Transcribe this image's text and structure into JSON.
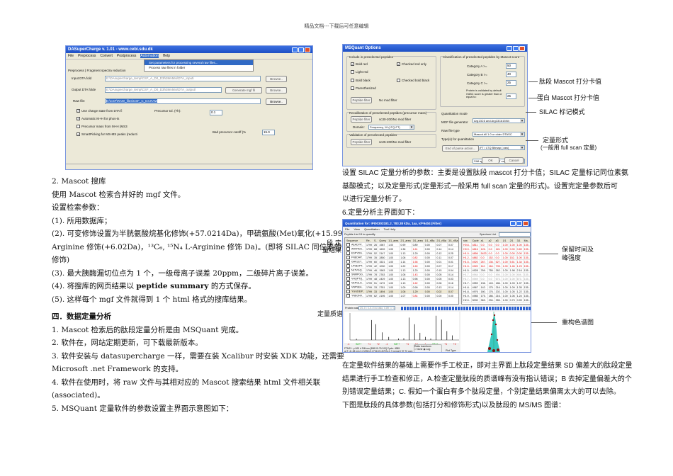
{
  "header": "精品文档---下载后可任意编辑",
  "dasc": {
    "title": "DASuperCharge v. 1.01  - www.cebi.sdu.dk",
    "menu": [
      "File",
      "Preprocess",
      "Convert",
      "Postprocess",
      "Automation",
      "Help"
    ],
    "dropdown": [
      "Set parameters for processing several raw files...",
      "Process raw files in folder"
    ],
    "tabs": [
      "Preprocess",
      "Fragment spectra reduction"
    ],
    "input_label": "Input DTA fold",
    "input_value": "E:\\DAsupercharge_temp\\CSF_A_D0_D3h38m56s\\DTA_input\\",
    "output_label": "Output DTA folde",
    "output_value": "E:\\DAsupercharge_temp\\CSF_A_D0_D3h38m56s\\DTA_output\\",
    "raw_label": "Raw file:",
    "raw_value": "E:\\CSF\\RAW_files\\CSF_C_D4.RAW",
    "browse": "Browse..",
    "generate": "Generate mgf fil",
    "checks": [
      {
        "label": "Use charge state from DTA fi",
        "checked": true
      },
      {
        "label": "Automatic M+H for phos-ts",
        "checked": true
      },
      {
        "label": "Precursor mass from M+H (MS3",
        "checked": false
      },
      {
        "label": "SmartPicking for MS-MS peaks (reducti",
        "checked": true
      }
    ],
    "tol_label": "Precursor tol. (Th):",
    "tol_value": "0.1",
    "cutoff_label": "Bad precursor cutoff (%",
    "cutoff_value": "15.0"
  },
  "left_text": {
    "l1": "2. Mascot 搜库",
    "l2": "使用 Mascot 检索合并好的 mgf 文件。",
    "l3": "设置检索参数：",
    "l4": "(1). 所用数据库；",
    "l5": "(2). 可变修饰设置为半胱氨酸烷基化修饰(+57.0214Da)，甲硫氨酸(Met)氧化(+15.99Da)，¹³C₆ L-",
    "l6": "Arginine 修饰(+6.02Da)，¹³C₆, ¹⁵N₄ L-Arginine 修饰 Da)。(即将 SILAC 同位素的修饰设置为可变",
    "l7": "修饰)",
    "l8": "(3). 最大胰酶漏切位点为 1 个，一级母离子误差 20ppm，二级碎片离子误差。",
    "l9a": "(4). 将搜库的网页结果以 ",
    "l9b": "peptide summary",
    "l9c": " 的方式保存。",
    "l10": "(5). 这样每个 mgf 文件就得到 1 个 html 格式的搜库结果。",
    "section": "四．数据定量分析",
    "s1": "1. Mascot 检索后的肽段定量分析是由 MSQuant 完成。",
    "s2": "2. 软件在，网站定期更新，可下载最新版本。",
    "s3": "3. 软件安装与 datasupercharge 一样，需要在装 Xcalibur 时安装 XDK 功能，还需要",
    "s4": "Microsoft .net Framework 的支持。",
    "s5": "4. 软件在使用时，将 raw 文件与其相对应的 Mascot 搜索结果 html 文件相关联",
    "s6": "(associated)。",
    "s7": "5. MSQuant 定量软件的参数设置主界面示意图如下："
  },
  "side_labels": {
    "quant_result": "段 定 量结果",
    "quant_spectrum": "定量质谱"
  },
  "msq": {
    "title": "MSQuant Options",
    "include_group": "Include in preselected peptides",
    "checks": [
      {
        "label": "Bold red",
        "checked": true
      },
      {
        "label": "Checked red only",
        "checked": true
      },
      {
        "label": "Light red",
        "checked": false
      },
      {
        "label": "Bold black",
        "checked": false
      },
      {
        "label": "Checked bold black",
        "checked": false
      },
      {
        "label": "Parenthesized",
        "checked": false
      }
    ],
    "peptide_filter": "Peptide filter",
    "no_mod_filter": "No mod filter",
    "recal_group": "Recalibration of preselected peptides (precursor mass)",
    "recal_filter": "sc30-200\\No mod filter",
    "domain_label": "Domain:",
    "domain_value": "Frequency, 1/f (LTQ-FT)",
    "valid_group": "Validation of preselected peptides",
    "valid_filter": "sc25-200\\No mod filter",
    "class_group": "Classification of preselected peptides by Mascot score",
    "cat_a": "Category A >=",
    "cat_a_val": "50",
    "cat_b": "Category B >=",
    "cat_b_val": "40",
    "cat_c": "Category C >=",
    "cat_c_val": "25",
    "protein_label": "Protein is validated by default if ABC score is greater than or equal to:",
    "protein_val": "25",
    "quant_mode_label": "Quantitation mode",
    "quant_mode": "Arg13C6 and Arg13C615N4",
    "mgf_label": "MGF file generator",
    "mgf": "Mascot.dll 1.0 or older DTASC",
    "raw_label": "Raw file type",
    "raw": "LTQ-FT / LTQ Bitmap (.raw)",
    "types_label": "Type(s) for quantitation",
    "types": "SIM spectra (LTQ-FT only)",
    "end_parse": "End of parse action...",
    "ok": "OK",
    "cancel": "Cancel"
  },
  "annotations": {
    "a1": "肽段 Mascot 打分卡值",
    "a2": "蛋白 Mascot 打分卡值",
    "a3": "SILAC 标记模式",
    "a4": "定量形式",
    "a5": "(一般用 full scan 定量)",
    "a6": "保留时间及",
    "a7": "峰强度",
    "a8": "重构色谱图"
  },
  "right_text": {
    "p1": "设置 SILAC 定量分析的参数：主要是设置肽段 mascot 打分卡值；SILAC 定量标记同位素氨",
    "p2": "基酸模式；以及定量形式(定量形式一般采用 full scan 定量的形式)。设置完定量参数后可",
    "p3": "以进行定量分析了。",
    "p4": "6.定量分析主界面如下：",
    "q1": "在定量软件结果的基础上需要作手工校正，即对主界面上肽段定量结果 SD 偏差大的肽段定量",
    "q2": "结果进行手工检查和修正，A.检查定量肽段的质谱峰有没有指认错误；B 去掉定量偏差大的个",
    "q3": "别错误定量结果；C. 假如一个蛋白有多个肽段定量，个别定量结果偏离太大的可以去除。",
    "q4": "下图是肽段的具体参数(包括打分和修饰形式)以及肽段的 MS/MS 图谱："
  },
  "quant": {
    "title": "Quantitation for: IPI00303181.2 ,783.38 kDa, 1aa, Id=9404 (Filter)",
    "menu": [
      "File",
      "View",
      "Quantitation",
      "Tool Help"
    ],
    "peptide_list": "Peptide List  13 to quantify",
    "spectrum_list": "Spectrum List",
    "pep_headers": [
      "Sequence",
      "Re..",
      "S..",
      "Query",
      "1/1_area",
      "2/1_area",
      "3/1_area",
      "1/1_rIBa",
      "2/1_rIBa",
      "3/1_rIBa",
      "1/1_SD"
    ],
    "pep_rows": [
      [
        "AEADYP..",
        "1799",
        "26",
        "1987",
        "1.00",
        "0.99",
        "0.89",
        "0.00",
        "0.07",
        "0.07",
        "1.00"
      ],
      [
        "ARVPEG..",
        "1799",
        "68",
        "1639",
        "1.00",
        "1.36",
        "1.61",
        "0.00",
        "0.14",
        "0.14",
        "1.00"
      ],
      [
        "ESPYDG..",
        "1799",
        "52",
        "2147",
        "1.00",
        "1.13",
        "1.29",
        "0.00",
        "0.12",
        "0.25",
        "1.00"
      ],
      [
        "FNEDHP..",
        "1799",
        "35",
        "2850",
        "1.00",
        "1.06",
        "0.82",
        "0.00",
        "0.11",
        "0.07",
        "1.00"
      ],
      [
        "GAKLEY..",
        "1799",
        "60",
        "1521",
        "1.00",
        "1.14",
        "1.56",
        "0.00",
        "0.01",
        "0.01",
        "1.00"
      ],
      [
        "LPSEJPT..",
        "1799",
        "42",
        "1030",
        "1.00",
        "1.22",
        "1.60",
        "0.00",
        "0.07",
        "0.17",
        "1.00"
      ],
      [
        "NLTVGQ..",
        "1799",
        "46",
        "1563",
        "1.00",
        "1.13",
        "1.20",
        "0.00",
        "0.15",
        "0.04",
        "1.00"
      ],
      [
        "SNMPGG..",
        "1799",
        "78",
        "2763",
        "1.00",
        "1.06",
        "1.43",
        "0.00",
        "0.05",
        "0.14",
        "1.00"
      ],
      [
        "VHQPTQ..",
        "1799",
        "48",
        "2429",
        "1.00",
        "1.13",
        "0.96",
        "0.00",
        "0.05",
        "0.03",
        "1.00"
      ],
      [
        "VEPGLG..",
        "1799",
        "51",
        "1173",
        "1.00",
        "1.13",
        "1.62",
        "0.00",
        "0.06",
        "0.16",
        "1.00"
      ],
      [
        "VNPSEA..",
        "1799",
        "33",
        "2781",
        "1.00",
        "1.09",
        "0.99",
        "0.00",
        "0.13",
        "0.14",
        "1.00"
      ],
      [
        "YGGDEIP..",
        "1799",
        "33",
        "1494",
        "1.00",
        "1.06",
        "1.29",
        "0.00",
        "0.02",
        "0.07",
        "1.00"
      ],
      [
        "YNEGNV..",
        "1799",
        "62",
        "2195",
        "1.00",
        "1.07",
        "0.84",
        "0.00",
        "0.00",
        "0.00",
        "1.00"
      ]
    ],
    "spec_headers": [
      "raw",
      "Cycle",
      "a1",
      "a2",
      "a3",
      "1/1",
      "2/1",
      "3/1",
      "Ma.."
    ],
    "spec_rows": [
      [
        "H0.8..",
        "4811",
        "0.0",
        "0.0",
        "0.0",
        "1.00",
        "1.00",
        "1.00",
        "135.."
      ],
      [
        "H0.9..",
        "4816",
        "126.",
        "0.0",
        "115.",
        "1.00",
        "0.00",
        "0.89",
        "135.."
      ],
      [
        "H1.0..",
        "4856",
        "5433",
        "0.0",
        "0.0",
        "1.00",
        "0.00",
        "0.00",
        "135.."
      ],
      [
        "H1.2..",
        "4882",
        "0.0",
        "152.",
        "0.0",
        "1.00",
        "152.",
        "1.00",
        "135.."
      ],
      [
        "H1.5..",
        "4920",
        "267.",
        "136.",
        "527.",
        "1.00",
        "5.51",
        "1.34",
        "135.."
      ],
      [
        "H1.5..",
        "4920",
        "112.",
        "164.",
        "705.",
        "1.00",
        "1.46",
        "1.23",
        "135.."
      ],
      [
        "H1.5..",
        "4928",
        "769.",
        "755.",
        "262.",
        "1.00",
        "1.98",
        "2.16",
        "135.."
      ],
      [
        "H1.7..",
        "4944",
        "0.0",
        "0.0",
        "494.",
        "1.00",
        "1.00",
        "404.",
        "135.."
      ],
      [
        "H1.7..",
        "4949",
        "0.0",
        "0.0",
        "673.",
        "1.00",
        "1.00",
        "673.",
        "135.."
      ],
      [
        "H1.7..",
        "4959",
        "136.",
        "143.",
        "186.",
        "1.00",
        "1.03",
        "1.37",
        "135.."
      ],
      [
        "H1.8..",
        "4967",
        "142.",
        "175.",
        "216.",
        "1.00",
        "1.09",
        "1.35",
        "135.."
      ],
      [
        "H1.8..",
        "4976",
        "180.",
        "176.",
        "202.",
        "1.00",
        "1.05",
        "1.22",
        "135.."
      ],
      [
        "H1.9..",
        "4985",
        "175.",
        "186.",
        "216.",
        "1.00",
        "1.06",
        "1.24",
        "135.."
      ],
      [
        "H2.0..",
        "5000",
        "363.",
        "294.",
        "355.",
        "1.00",
        "0.73",
        "0.99",
        "135.."
      ]
    ],
    "protein_ratio_label": "Protein ratio:",
    "protein_ratio": "2/1.0 = 1/1.0 no ratio; 0.89 => 1.00",
    "ratio_marks": [
      "-1",
      "S3++",
      "+1",
      "+2",
      "-1",
      "S3++",
      "+1",
      "+2",
      "-1",
      "S3++",
      "+1",
      "+2"
    ],
    "status1": "FTMS + p NSI d SIM ms [698.00-710.00] Cycle: 4985",
    "status2": "at T: 41.38 min  0.21998 (0.27311)S:@FIN=1.7 mergeX 97.70 ppm",
    "ratio_transform": "Ratio transform",
    "log_label": "Log",
    "none_label": "None",
    "plot_type": "Plot Type"
  },
  "spectrum_peaks": [
    [
      0.06,
      0.05
    ],
    [
      0.2,
      0.78
    ],
    [
      0.24,
      0.62
    ],
    [
      0.3,
      0.3
    ],
    [
      0.36,
      0.12
    ],
    [
      0.45,
      0.06
    ],
    [
      0.5,
      0.07
    ],
    [
      0.55,
      0.88
    ],
    [
      0.6,
      0.62
    ],
    [
      0.65,
      0.28
    ],
    [
      0.7,
      0.12
    ],
    [
      0.75,
      0.06
    ],
    [
      0.8,
      0.95
    ],
    [
      0.85,
      0.8
    ],
    [
      0.9,
      0.35
    ],
    [
      0.95,
      0.18
    ]
  ]
}
